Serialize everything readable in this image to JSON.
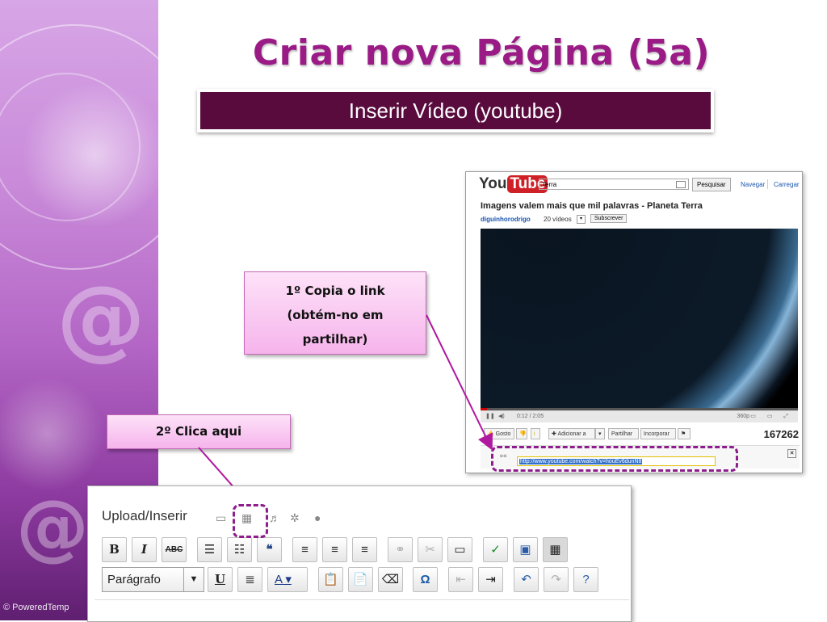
{
  "slide": {
    "title": "Criar nova Página (5a)",
    "subtitle": "Inserir Vídeo (youtube)",
    "watermark": "© PoweredTemp"
  },
  "colors": {
    "title": "#9a1b86",
    "subtitle_bg": "#5a0b3e",
    "callout_bg": "#f6b4ec",
    "dashed_highlight": "#8d1d8b",
    "arrow": "#b0199f"
  },
  "callouts": {
    "step1_line1": "1º Copia o link",
    "step1_line2": "(obtém-no em",
    "step1_line3": "partilhar)",
    "step2": "2º Clica aqui"
  },
  "youtube": {
    "logo_you": "You",
    "logo_tube": "Tube",
    "search_value": "Terra",
    "search_button": "Pesquisar",
    "nav_browse": "Navegar",
    "nav_upload": "Carregar",
    "video_title": "Imagens valem mais que mil palavras - Planeta Terra",
    "channel": "diguinhorodrigo",
    "video_count": "20 vídeos",
    "subscribe": "Subscrever",
    "time": "0:12 / 2:05",
    "quality": "360p",
    "like": "Gosto",
    "add_to": "Adicionar a",
    "share": "Partilhar",
    "embed": "Incorporar",
    "views": "167262",
    "share_url": "http://www.youtube.com/watch?v=houEv6dunN8"
  },
  "editor": {
    "upload_label": "Upload/Inserir",
    "format_select": "Parágrafo",
    "icons": [
      "image-icon",
      "video-icon",
      "audio-icon",
      "media-icon",
      "globe-icon",
      "bold-icon",
      "italic-icon",
      "strikethrough-icon",
      "bullet-list-icon",
      "numbered-list-icon",
      "blockquote-icon",
      "align-left-icon",
      "align-center-icon",
      "align-right-icon",
      "link-icon",
      "unlink-icon",
      "more-tag-icon",
      "spellcheck-icon",
      "fullscreen-icon",
      "kitchen-sink-icon",
      "underline-icon",
      "justify-icon",
      "text-color-icon",
      "paste-text-icon",
      "paste-word-icon",
      "remove-format-icon",
      "special-char-icon",
      "outdent-icon",
      "indent-icon",
      "undo-icon",
      "redo-icon",
      "help-icon"
    ],
    "bold": "B",
    "italic": "I",
    "strike": "ABC",
    "underline": "U",
    "text_color": "A",
    "special_char": "Ω"
  }
}
